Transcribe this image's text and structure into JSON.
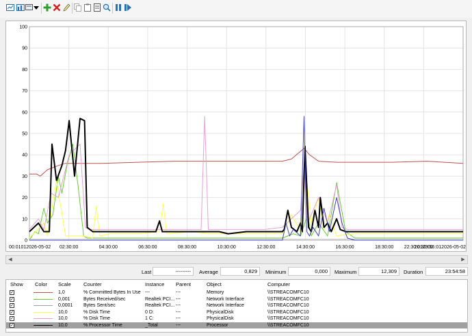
{
  "toolbar": {
    "icons": [
      "view-graph-icon",
      "change-graph-type-icon",
      "dropdown-arrow-icon",
      "add-counter-icon",
      "delete-counter-icon",
      "highlight-icon",
      "copy-properties-icon",
      "paste-counter-list-icon",
      "properties-icon",
      "zoom-icon",
      "freeze-display-icon",
      "update-data-icon"
    ]
  },
  "chart_data": {
    "type": "line",
    "ylim": [
      0,
      100
    ],
    "yticks": [
      "100",
      "90",
      "80",
      "70",
      "60",
      "50",
      "40",
      "30",
      "20",
      "10",
      "0"
    ],
    "xticks": [
      "00:01012026-05-02",
      "02:30:00",
      "04:30:00",
      "06:30:00",
      "08:30:00",
      "10:30:00",
      "12:30:00",
      "14:30:00",
      "16:30:00",
      "18:30:00",
      "20:30:00",
      "22:30:0123:56:012026-05-02"
    ],
    "series": [
      {
        "name": "% Committed Bytes In Use",
        "color": "#c0504d",
        "width": 1,
        "x": [
          0,
          0.4,
          0.6,
          1,
          1.3,
          1.6,
          2,
          3,
          4,
          6,
          8,
          10,
          12,
          14,
          14.5,
          15.2,
          15.5,
          16,
          17,
          18,
          20,
          22,
          24
        ],
        "y": [
          31,
          31,
          30,
          33,
          34,
          35,
          36,
          36,
          36,
          36.5,
          37,
          37,
          37,
          37,
          38,
          43,
          40,
          37,
          36.5,
          36.5,
          36.5,
          37,
          36
        ]
      },
      {
        "name": "Bytes Received/sec",
        "color": "#66cc33",
        "width": 1,
        "x": [
          0,
          0.3,
          0.5,
          0.8,
          1,
          1.3,
          1.6,
          1.8,
          2.1,
          2.4,
          2.7,
          3,
          3.2,
          4,
          6,
          8,
          10,
          12,
          14,
          14.6,
          15,
          15.4,
          15.6,
          16,
          16.5,
          17,
          17.5,
          18,
          20,
          22,
          24
        ],
        "y": [
          0,
          4,
          3,
          15,
          8,
          12,
          30,
          22,
          36,
          45,
          25,
          2,
          1,
          1,
          1,
          1,
          1,
          1,
          1,
          3,
          2,
          12,
          2,
          8,
          2,
          27,
          4,
          1,
          1,
          1,
          1
        ]
      },
      {
        "name": "Bytes Sent/sec",
        "color": "#c8c8c8",
        "width": 1,
        "x": [
          0,
          2,
          4,
          6,
          8,
          10,
          12,
          14,
          16,
          18,
          20,
          22,
          24
        ],
        "y": [
          0.5,
          0.5,
          0.5,
          0.5,
          0.5,
          0.5,
          0.5,
          0.5,
          0.5,
          0.5,
          0.5,
          0.5,
          0.5
        ]
      },
      {
        "name": "% Disk Time",
        "color": "#ffff44",
        "width": 1,
        "x": [
          0,
          0.8,
          1,
          1.5,
          2,
          3,
          3.5,
          3.7,
          3.9,
          4.5,
          6,
          7.2,
          7.4,
          7.6,
          9,
          10,
          12,
          14,
          14.5,
          15,
          15.3,
          15.6,
          16,
          16.3,
          16.6,
          17,
          18,
          20,
          22,
          24
        ],
        "y": [
          1,
          8,
          2,
          28,
          2,
          2,
          1,
          16,
          2,
          3,
          3,
          4,
          17,
          3,
          4,
          3,
          3,
          3,
          12,
          4,
          32,
          8,
          20,
          5,
          12,
          2,
          3,
          3,
          3,
          3
        ]
      },
      {
        "name": "% Disk Time",
        "color": "#e6a0d2",
        "width": 1,
        "x": [
          0,
          0.5,
          0.8,
          1.2,
          1.6,
          2.2,
          2.8,
          3.1,
          3.3,
          4,
          6,
          8,
          9.5,
          9.7,
          9.9,
          11,
          13,
          14,
          14.5,
          15,
          15.2,
          15.4,
          15.6,
          16,
          16.5,
          17,
          17.3,
          17.6,
          18,
          20,
          22,
          24
        ],
        "y": [
          5,
          10,
          5,
          22,
          20,
          40,
          45,
          6,
          5,
          5,
          5,
          5,
          5,
          58,
          5,
          5,
          5,
          6,
          10,
          14,
          35,
          8,
          12,
          20,
          8,
          26,
          6,
          5,
          5,
          5,
          5,
          5
        ]
      },
      {
        "name": "% Processor Time",
        "color": "#000000",
        "width": 2,
        "x": [
          0,
          0.5,
          0.8,
          1.1,
          1.25,
          1.5,
          1.8,
          2,
          2.2,
          2.5,
          2.8,
          3.05,
          3.2,
          3.5,
          4,
          5,
          6,
          7,
          7.2,
          7.35,
          7.5,
          8,
          8.5,
          9,
          10,
          10.5,
          11,
          12,
          13,
          14,
          14.1,
          14.3,
          14.5,
          14.8,
          15,
          15.1,
          15.25,
          15.45,
          15.6,
          15.8,
          16,
          16.1,
          16.3,
          16.5,
          16.7,
          17,
          17.2,
          17.5,
          18,
          20,
          22,
          24
        ],
        "y": [
          4,
          8,
          4,
          4,
          45,
          28,
          35,
          42,
          56,
          30,
          57,
          56,
          6,
          4,
          4,
          4,
          4,
          4,
          9,
          4,
          4,
          4,
          4,
          4,
          4,
          4,
          3,
          4,
          4,
          4,
          5,
          14,
          6,
          4,
          8,
          4,
          44,
          6,
          4,
          14,
          6,
          20,
          6,
          8,
          4,
          10,
          5,
          4,
          4,
          4,
          4,
          4
        ]
      },
      {
        "name": "% Disk Time",
        "color": "#4040c0",
        "width": 1,
        "x": [
          0,
          14,
          14.2,
          14.4,
          14.6,
          15,
          15.2,
          15.35,
          15.5,
          15.7,
          16,
          16.3,
          16.6,
          17,
          17.3,
          17.6,
          18,
          24
        ],
        "y": [
          0,
          0,
          8,
          2,
          5,
          2,
          58,
          4,
          2,
          6,
          2,
          15,
          4,
          20,
          8,
          1,
          0,
          0
        ]
      }
    ]
  },
  "stats": {
    "last_label": "Last",
    "last_value": "---------",
    "average_label": "Average",
    "average_value": "0,829",
    "minimum_label": "Minimum",
    "minimum_value": "0,000",
    "maximum_label": "Maximum",
    "maximum_value": "12,309",
    "duration_label": "Duration",
    "duration_value": "23:54:58"
  },
  "legend": {
    "headers": {
      "show": "Show",
      "color": "Color",
      "scale": "Scale",
      "counter": "Counter",
      "instance": "Instance",
      "parent": "Parent",
      "object": "Object",
      "computer": "Computer"
    },
    "rows": [
      {
        "color": "#c0504d",
        "scale": "1,0",
        "counter": "% Committed Bytes In Use",
        "instance": "---",
        "parent": "---",
        "object": "Memory",
        "computer": "\\\\STREACOMFC10"
      },
      {
        "color": "#66cc33",
        "scale": "0,001",
        "counter": "Bytes Received/sec",
        "instance": "Realtek PCI...",
        "parent": "---",
        "object": "Network Interface",
        "computer": "\\\\STREACOMFC10"
      },
      {
        "color": "#a0a0a0",
        "scale": "0,0001",
        "counter": "Bytes Sent/sec",
        "instance": "Realtek PCI...",
        "parent": "---",
        "object": "Network Interface",
        "computer": "\\\\STREACOMFC10"
      },
      {
        "color": "#ffff44",
        "scale": "10,0",
        "counter": "% Disk Time",
        "instance": "0 D:",
        "parent": "---",
        "object": "PhysicalDisk",
        "computer": "\\\\STREACOMFC10"
      },
      {
        "color": "#e6a0d2",
        "scale": "10,0",
        "counter": "% Disk Time",
        "instance": "1 C:",
        "parent": "---",
        "object": "PhysicalDisk",
        "computer": "\\\\STREACOMFC10"
      },
      {
        "color": "#000000",
        "scale": "10,0",
        "counter": "% Processor Time",
        "instance": "_Total",
        "parent": "---",
        "object": "Processor",
        "computer": "\\\\STREACOMFC10"
      }
    ]
  }
}
